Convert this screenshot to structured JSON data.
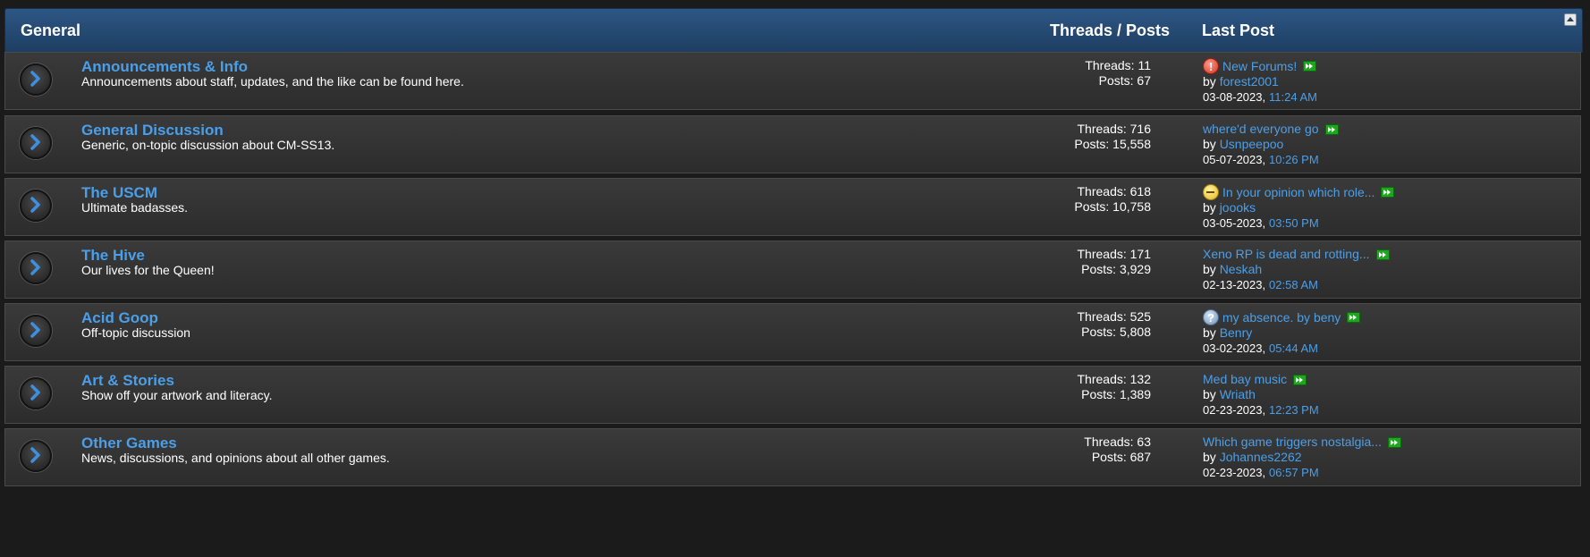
{
  "header": {
    "section_title": "General",
    "threads_posts_label": "Threads / Posts",
    "last_post_label": "Last Post"
  },
  "forums": [
    {
      "title": "Announcements & Info",
      "description": "Announcements about staff, updates, and the like can be found here.",
      "threads": "Threads: 11",
      "posts": "Posts: 67",
      "last_post_title": "New Forums!",
      "last_post_prefix_icon": "warning-icon",
      "by_label": "by",
      "last_post_user": "forest2001",
      "last_post_date": "03-08-2023,",
      "last_post_time": "11:24 AM"
    },
    {
      "title": "General Discussion",
      "description": "Generic, on-topic discussion about CM-SS13.",
      "threads": "Threads: 716",
      "posts": "Posts: 15,558",
      "last_post_title": "where'd everyone go",
      "last_post_prefix_icon": "",
      "by_label": "by",
      "last_post_user": "Usnpeepoo",
      "last_post_date": "05-07-2023,",
      "last_post_time": "10:26 PM"
    },
    {
      "title": "The USCM",
      "description": "Ultimate badasses.",
      "threads": "Threads: 618",
      "posts": "Posts: 10,758",
      "last_post_title": "In your opinion which role...",
      "last_post_prefix_icon": "neutral-face-icon",
      "by_label": "by",
      "last_post_user": "joooks",
      "last_post_date": "03-05-2023,",
      "last_post_time": "03:50 PM"
    },
    {
      "title": "The Hive",
      "description": "Our lives for the Queen!",
      "threads": "Threads: 171",
      "posts": "Posts: 3,929",
      "last_post_title": "Xeno RP is dead and rotting...",
      "last_post_prefix_icon": "",
      "by_label": "by",
      "last_post_user": "Neskah",
      "last_post_date": "02-13-2023,",
      "last_post_time": "02:58 AM"
    },
    {
      "title": "Acid Goop",
      "description": "Off-topic discussion",
      "threads": "Threads: 525",
      "posts": "Posts: 5,808",
      "last_post_title": "my absence. by beny",
      "last_post_prefix_icon": "question-icon",
      "by_label": "by",
      "last_post_user": "Benry",
      "last_post_date": "03-02-2023,",
      "last_post_time": "05:44 AM"
    },
    {
      "title": "Art & Stories",
      "description": "Show off your artwork and literacy.",
      "threads": "Threads: 132",
      "posts": "Posts: 1,389",
      "last_post_title": "Med bay music",
      "last_post_prefix_icon": "",
      "by_label": "by",
      "last_post_user": "Wriath",
      "last_post_date": "02-23-2023,",
      "last_post_time": "12:23 PM"
    },
    {
      "title": "Other Games",
      "description": "News, discussions, and opinions about all other games.",
      "threads": "Threads: 63",
      "posts": "Posts: 687",
      "last_post_title": "Which game triggers nostalgia...",
      "last_post_prefix_icon": "",
      "by_label": "by",
      "last_post_user": "Johannes2262",
      "last_post_date": "02-23-2023,",
      "last_post_time": "06:57 PM"
    }
  ],
  "colors": {
    "link": "#4b9fe9",
    "header_bg": "#2d5784",
    "row_bg": "#333333",
    "page_bg": "#1b1b1b"
  }
}
